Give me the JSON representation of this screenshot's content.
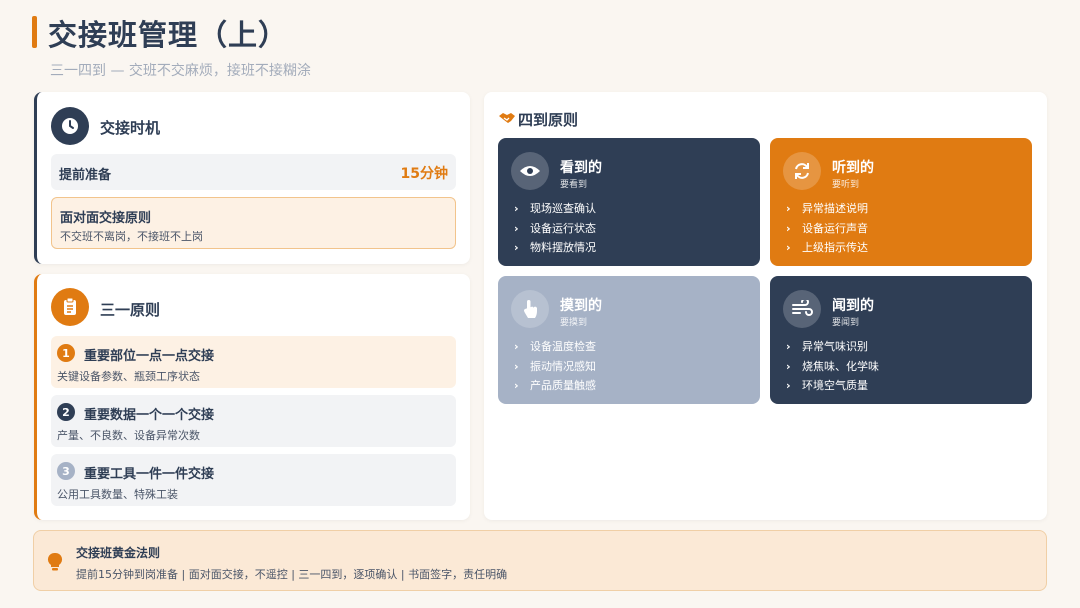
{
  "header": {
    "title": "交接班管理（上）",
    "subtitle": "三一四到 — 交班不交麻烦，接班不接糊涂"
  },
  "timing_card": {
    "title": "交接时机",
    "icon": "clock-icon",
    "prep_label": "提前准备",
    "prep_value": "15分钟",
    "principle_title": "面对面交接原则",
    "principle_desc": "不交班不离岗，不接班不上岗"
  },
  "three_one": {
    "title": "三一原则",
    "icon": "clipboard-icon",
    "items": [
      {
        "num": "1",
        "title": "重要部位一点一点交接",
        "desc": "关键设备参数、瓶颈工序状态"
      },
      {
        "num": "2",
        "title": "重要数据一个一个交接",
        "desc": "产量、不良数、设备异常次数"
      },
      {
        "num": "3",
        "title": "重要工具一件一件交接",
        "desc": "公用工具数量、特殊工装"
      }
    ]
  },
  "four_arrive": {
    "title": "四到原则",
    "icon": "handshake-icon",
    "tiles": [
      {
        "name": "看到的",
        "sub": "要看到",
        "icon": "eye-icon",
        "color": "#2f3e55",
        "items": [
          "现场巡查确认",
          "设备运行状态",
          "物料摆放情况"
        ]
      },
      {
        "name": "听到的",
        "sub": "要听到",
        "icon": "sync-icon",
        "color": "#e07b12",
        "items": [
          "异常描述说明",
          "设备运行声音",
          "上级指示传达"
        ]
      },
      {
        "name": "摸到的",
        "sub": "要摸到",
        "icon": "hand-pointer-icon",
        "color": "#a6b2c6",
        "items": [
          "设备温度检查",
          "振动情况感知",
          "产品质量触感"
        ]
      },
      {
        "name": "闻到的",
        "sub": "要闻到",
        "icon": "wind-icon",
        "color": "#2f3e55",
        "items": [
          "异常气味识别",
          "烧焦味、化学味",
          "环境空气质量"
        ]
      }
    ]
  },
  "footer": {
    "title": "交接班黄金法则",
    "text": "提前15分钟到岗准备 | 面对面交接，不遥控 | 三一四到，逐项确认 | 书面签字，责任明确",
    "icon": "lightbulb-icon"
  },
  "colors": {
    "navy": "#2f3e55",
    "orange": "#e07b12",
    "slate": "#a6b2c6"
  }
}
